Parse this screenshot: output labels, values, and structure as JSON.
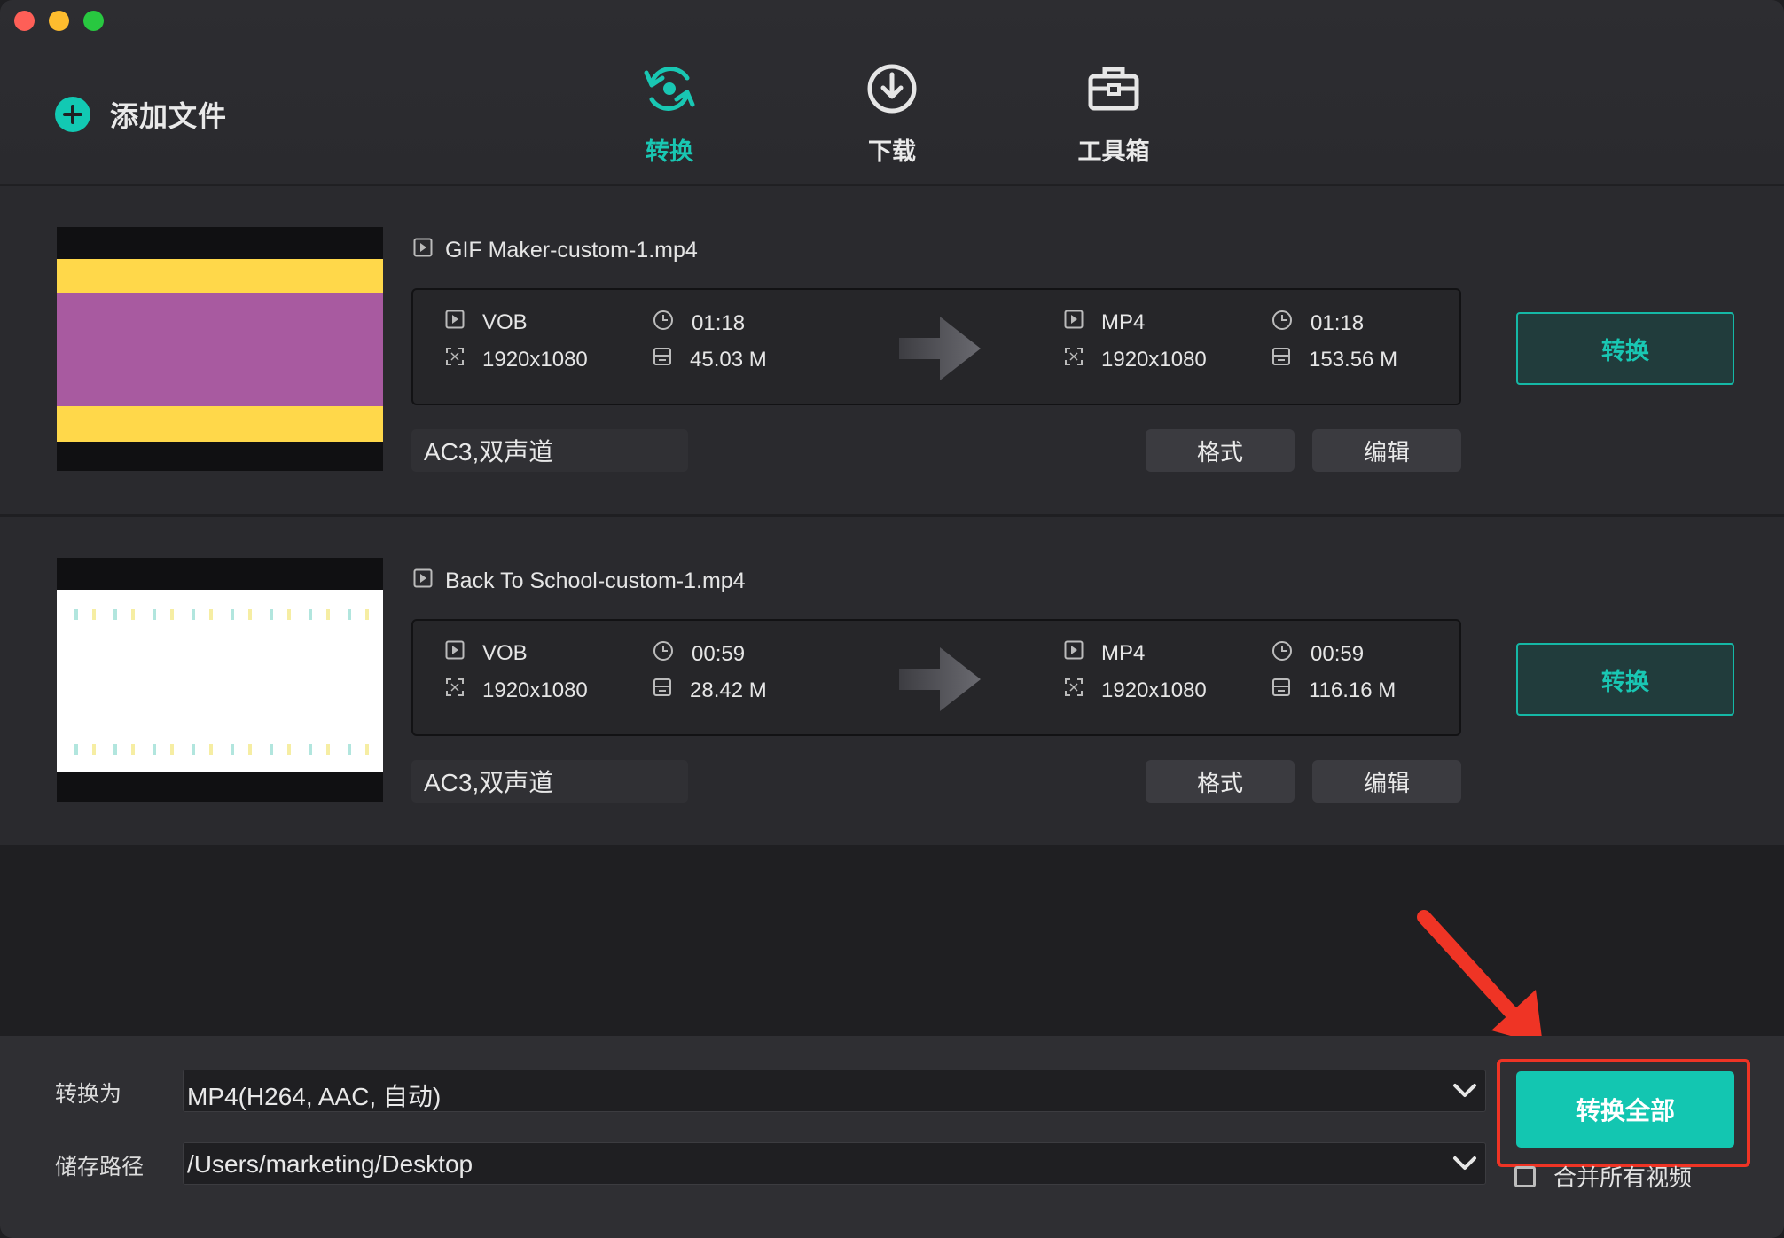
{
  "window": {
    "traffic_lights": [
      "close",
      "minimize",
      "maximize"
    ]
  },
  "toolbar": {
    "add_file_label": "添加文件",
    "tabs": [
      {
        "label": "转换",
        "icon": "convert-refresh-icon",
        "active": true
      },
      {
        "label": "下载",
        "icon": "download-icon",
        "active": false
      },
      {
        "label": "工具箱",
        "icon": "toolbox-icon",
        "active": false
      }
    ]
  },
  "files": [
    {
      "name": "GIF Maker-custom-1.mp4",
      "source": {
        "format": "VOB",
        "duration": "01:18",
        "resolution": "1920x1080",
        "size": "45.03 M"
      },
      "target": {
        "format": "MP4",
        "duration": "01:18",
        "resolution": "1920x1080",
        "size": "153.56 M"
      },
      "audio": "AC3,双声道",
      "format_btn": "格式",
      "edit_btn": "编辑",
      "convert_btn": "转换"
    },
    {
      "name": "Back To School-custom-1.mp4",
      "source": {
        "format": "VOB",
        "duration": "00:59",
        "resolution": "1920x1080",
        "size": "28.42 M"
      },
      "target": {
        "format": "MP4",
        "duration": "00:59",
        "resolution": "1920x1080",
        "size": "116.16 M"
      },
      "audio": "AC3,双声道",
      "format_btn": "格式",
      "edit_btn": "编辑",
      "convert_btn": "转换"
    }
  ],
  "bottom": {
    "convert_to_label": "转换为",
    "convert_to_value": "MP4(H264, AAC, 自动)",
    "save_path_label": "储存路径",
    "save_path_value": "/Users/marketing/Desktop",
    "convert_all_label": "转换全部",
    "merge_label": "合并所有视频",
    "merge_checked": false
  },
  "colors": {
    "accent": "#13c6b1",
    "annotation_red": "#ef3425",
    "background": "#1f1f22"
  }
}
